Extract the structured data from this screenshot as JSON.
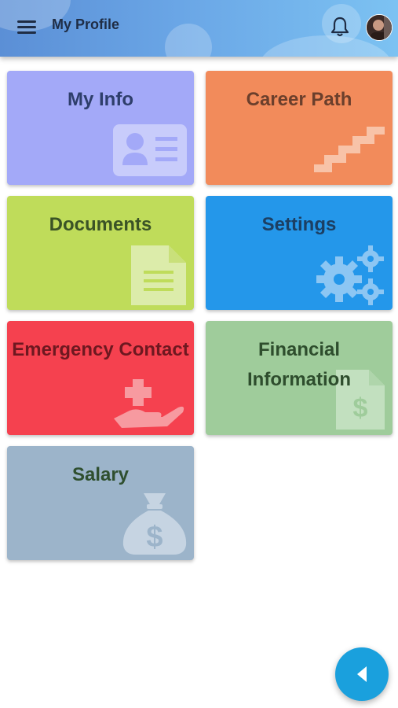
{
  "header": {
    "title": "My Profile",
    "menu_icon": "hamburger-menu-icon",
    "notification_icon": "bell-icon",
    "avatar": "user-avatar"
  },
  "tiles": [
    {
      "label": "My Info",
      "icon": "id-card-icon",
      "color": "#a3a9f8"
    },
    {
      "label": "Career Path",
      "icon": "stairs-icon",
      "color": "#f28b5b"
    },
    {
      "label": "Documents",
      "icon": "document-icon",
      "color": "#bfdc5a"
    },
    {
      "label": "Settings",
      "icon": "gears-icon",
      "color": "#2497ea"
    },
    {
      "label": "Emergency Contact",
      "icon": "hand-medical-icon",
      "color": "#f5414f"
    },
    {
      "label": "Financial Information",
      "icon": "invoice-dollar-icon",
      "color": "#9fcc9b"
    },
    {
      "label": "Salary",
      "icon": "money-bag-icon",
      "color": "#9cb4ca"
    }
  ],
  "fab": {
    "icon": "caret-left-icon",
    "color": "#1aa0dd"
  }
}
